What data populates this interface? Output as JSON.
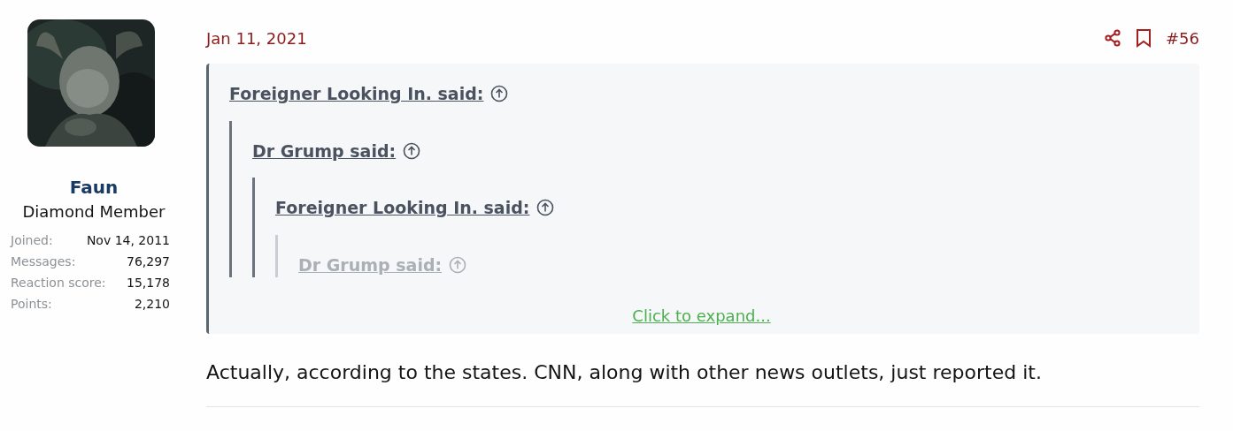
{
  "user": {
    "name": "Faun",
    "title": "Diamond Member",
    "stats": [
      {
        "label": "Joined:",
        "value": "Nov 14, 2011"
      },
      {
        "label": "Messages:",
        "value": "76,297"
      },
      {
        "label": "Reaction score:",
        "value": "15,178"
      },
      {
        "label": "Points:",
        "value": "2,210"
      }
    ]
  },
  "post": {
    "date": "Jan 11, 2021",
    "number": "#56",
    "quote": {
      "author": "Foreigner Looking In. said:",
      "faded": false,
      "children": [
        {
          "author": "Dr Grump said:",
          "faded": false,
          "children": [
            {
              "author": "Foreigner Looking In. said:",
              "faded": false,
              "children": [
                {
                  "author": "Dr Grump said:",
                  "faded": true
                }
              ]
            }
          ]
        }
      ]
    },
    "expand": "Click to expand...",
    "body": "Actually, according to the states. CNN, along with other news outlets, just reported it."
  }
}
